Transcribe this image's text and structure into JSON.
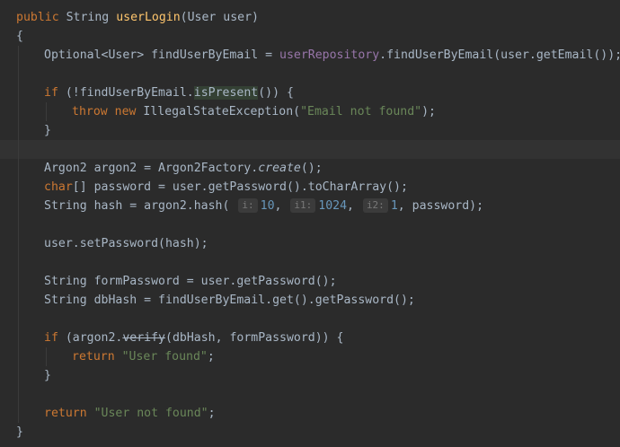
{
  "editor": {
    "caret_line_index": 7,
    "lines": [
      {
        "indent": 0,
        "tokens": [
          {
            "t": "public",
            "c": "kw"
          },
          {
            "t": " "
          },
          {
            "t": "String"
          },
          {
            "t": " "
          },
          {
            "t": "userLogin",
            "c": "fn"
          },
          {
            "t": "(User user)"
          }
        ]
      },
      {
        "indent": 0,
        "tokens": [
          {
            "t": "{"
          }
        ]
      },
      {
        "indent": 1,
        "tokens": [
          {
            "t": "Optional<User> findUserByEmail = "
          },
          {
            "t": "userRepository",
            "c": "field"
          },
          {
            "t": ".findUserByEmail(user.getEmail());"
          }
        ]
      },
      {
        "indent": 1,
        "tokens": []
      },
      {
        "indent": 1,
        "tokens": [
          {
            "t": "if",
            "c": "kw"
          },
          {
            "t": " (!findUserByEmail."
          },
          {
            "t": "isPresent",
            "c": "highlight"
          },
          {
            "t": "()) {"
          }
        ]
      },
      {
        "indent": 2,
        "tokens": [
          {
            "t": "throw",
            "c": "kw"
          },
          {
            "t": " "
          },
          {
            "t": "new",
            "c": "kw"
          },
          {
            "t": " IllegalStateException("
          },
          {
            "t": "\"Email not found\"",
            "c": "str"
          },
          {
            "t": ");"
          }
        ]
      },
      {
        "indent": 1,
        "tokens": [
          {
            "t": "}"
          }
        ]
      },
      {
        "indent": 1,
        "tokens": []
      },
      {
        "indent": 1,
        "tokens": [
          {
            "t": "Argon2 argon2 = Argon2Factory."
          },
          {
            "t": "create",
            "c": "static-call"
          },
          {
            "t": "();"
          }
        ]
      },
      {
        "indent": 1,
        "tokens": [
          {
            "t": "char",
            "c": "kw"
          },
          {
            "t": "[] password = user.getPassword().toCharArray();"
          }
        ]
      },
      {
        "indent": 1,
        "tokens": [
          {
            "t": "String hash = argon2.hash( "
          },
          {
            "t": "i:",
            "c": "hint"
          },
          {
            "t": "10",
            "c": "num"
          },
          {
            "t": ", "
          },
          {
            "t": "i1:",
            "c": "hint"
          },
          {
            "t": "1024",
            "c": "num"
          },
          {
            "t": ", "
          },
          {
            "t": "i2:",
            "c": "hint"
          },
          {
            "t": "1",
            "c": "num"
          },
          {
            "t": ", password);"
          }
        ]
      },
      {
        "indent": 1,
        "tokens": []
      },
      {
        "indent": 1,
        "tokens": [
          {
            "t": "user.setPassword(hash);"
          }
        ]
      },
      {
        "indent": 1,
        "tokens": []
      },
      {
        "indent": 1,
        "tokens": [
          {
            "t": "String formPassword = user.getPassword();"
          }
        ]
      },
      {
        "indent": 1,
        "tokens": [
          {
            "t": "String dbHash = findUserByEmail.get().getPassword();"
          }
        ]
      },
      {
        "indent": 1,
        "tokens": []
      },
      {
        "indent": 1,
        "tokens": [
          {
            "t": "if",
            "c": "kw"
          },
          {
            "t": " (argon2."
          },
          {
            "t": "verify",
            "c": "deprecated"
          },
          {
            "t": "(dbHash, formPassword)) {"
          }
        ]
      },
      {
        "indent": 2,
        "tokens": [
          {
            "t": "return",
            "c": "kw"
          },
          {
            "t": " "
          },
          {
            "t": "\"User found\"",
            "c": "str"
          },
          {
            "t": ";"
          }
        ]
      },
      {
        "indent": 1,
        "tokens": [
          {
            "t": "}"
          }
        ]
      },
      {
        "indent": 1,
        "tokens": []
      },
      {
        "indent": 1,
        "tokens": [
          {
            "t": "return",
            "c": "kw"
          },
          {
            "t": " "
          },
          {
            "t": "\"User not found\"",
            "c": "str"
          },
          {
            "t": ";"
          }
        ]
      },
      {
        "indent": 0,
        "tokens": [
          {
            "t": "}"
          }
        ]
      }
    ]
  }
}
